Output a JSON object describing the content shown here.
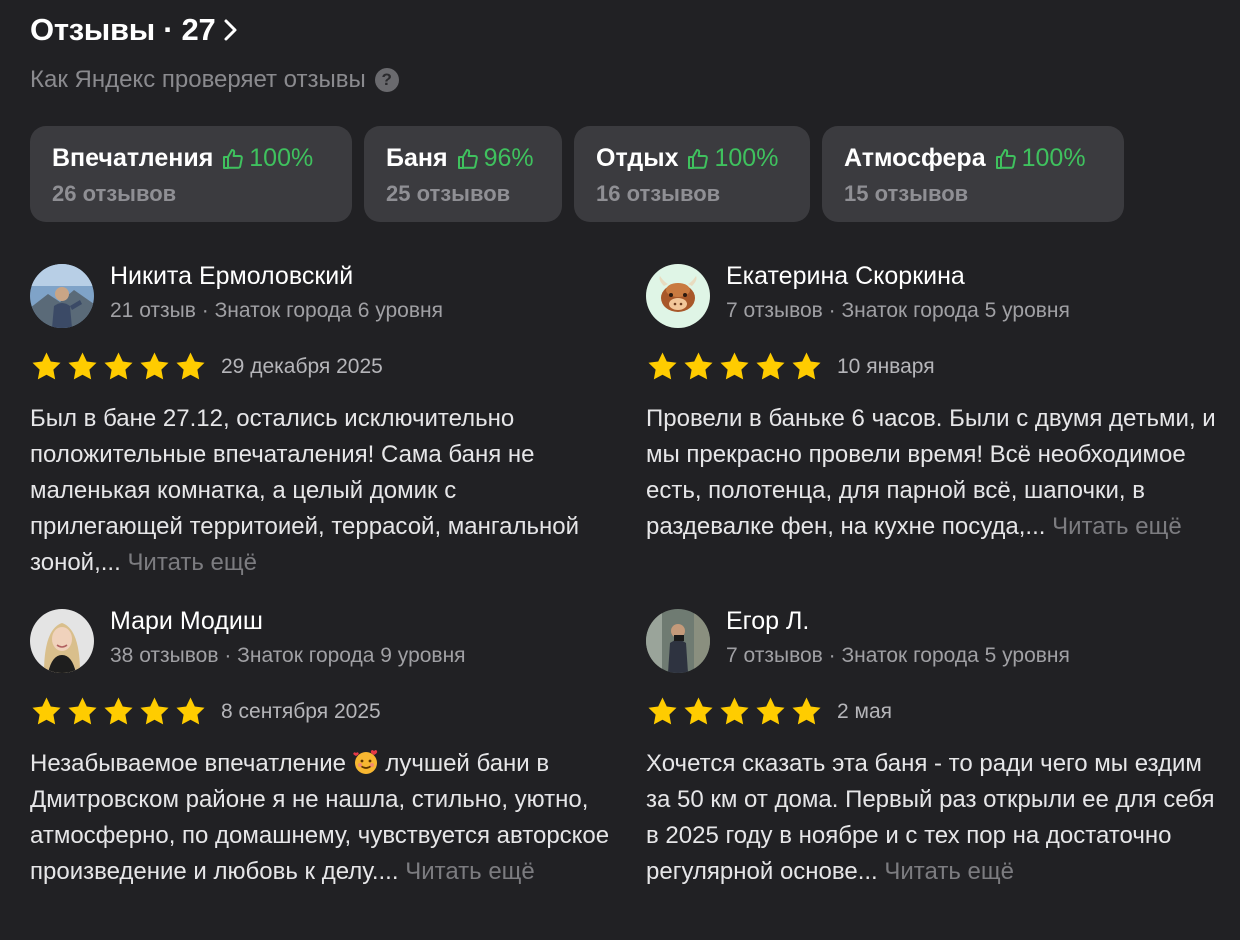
{
  "header": {
    "title": "Отзывы · 27",
    "subtitle": "Как Яндекс проверяет отзывы",
    "help_icon": "?"
  },
  "aspects": [
    {
      "name": "Впечатления",
      "percent": "100%",
      "count": "26 отзывов"
    },
    {
      "name": "Баня",
      "percent": "96%",
      "count": "25 отзывов"
    },
    {
      "name": "Отдых",
      "percent": "100%",
      "count": "16 отзывов"
    },
    {
      "name": "Атмосфера",
      "percent": "100%",
      "count": "15 отзывов"
    }
  ],
  "reviews": [
    {
      "author": "Никита Ермоловский",
      "meta": "21 отзыв · Знаток города 6 уровня",
      "rating": 5,
      "date": "29 декабря 2025",
      "text": "Был в бане 27.12, остались исключительно положительные впечаталения! Сама баня не маленькая комнатка, а целый домик с прилегающей территоией, террасой, мангальной зоной,...",
      "more": "Читать ещё",
      "avatar_icon": "photo-avatar-mountain"
    },
    {
      "author": "Екатерина Скоркина",
      "meta": "7 отзывов · Знаток города 5 уровня",
      "rating": 5,
      "date": "10 января",
      "text": "Провели в баньке 6 часов. Были с двумя детьми, и мы прекрасно провели время! Всё необходимое есть, полотенца, для парной всё, шапочки, в раздевалке фен, на кухне посуда,...",
      "more": "Читать ещё",
      "avatar_icon": "yak-avatar-icon"
    },
    {
      "author": "Мари Модиш",
      "meta": "38 отзывов · Знаток города 9 уровня",
      "rating": 5,
      "date": "8 сентября 2025",
      "text_before": "Незабываемое впечатление",
      "text_after": " лучшей бани в Дмитровском районе я не нашла, стильно, уютно, атмосферно, по домашнему, чувствуется авторское произведение и любовь к делу....",
      "more": "Читать ещё",
      "avatar_icon": "photo-avatar-woman"
    },
    {
      "author": "Егор Л.",
      "meta": "7 отзывов · Знаток города 5 уровня",
      "rating": 5,
      "date": "2 мая",
      "text": "Хочется сказать эта баня - то ради чего мы ездим за 50 км от дома. Первый раз открыли ее для себя в 2025 году в ноябре и с тех пор на достаточно регулярной основе...",
      "more": "Читать ещё",
      "avatar_icon": "photo-avatar-man"
    }
  ],
  "colors": {
    "background": "#212124",
    "chip_bg": "#3b3b3f",
    "positive": "#3fc15e",
    "star": "#ffcc00"
  }
}
